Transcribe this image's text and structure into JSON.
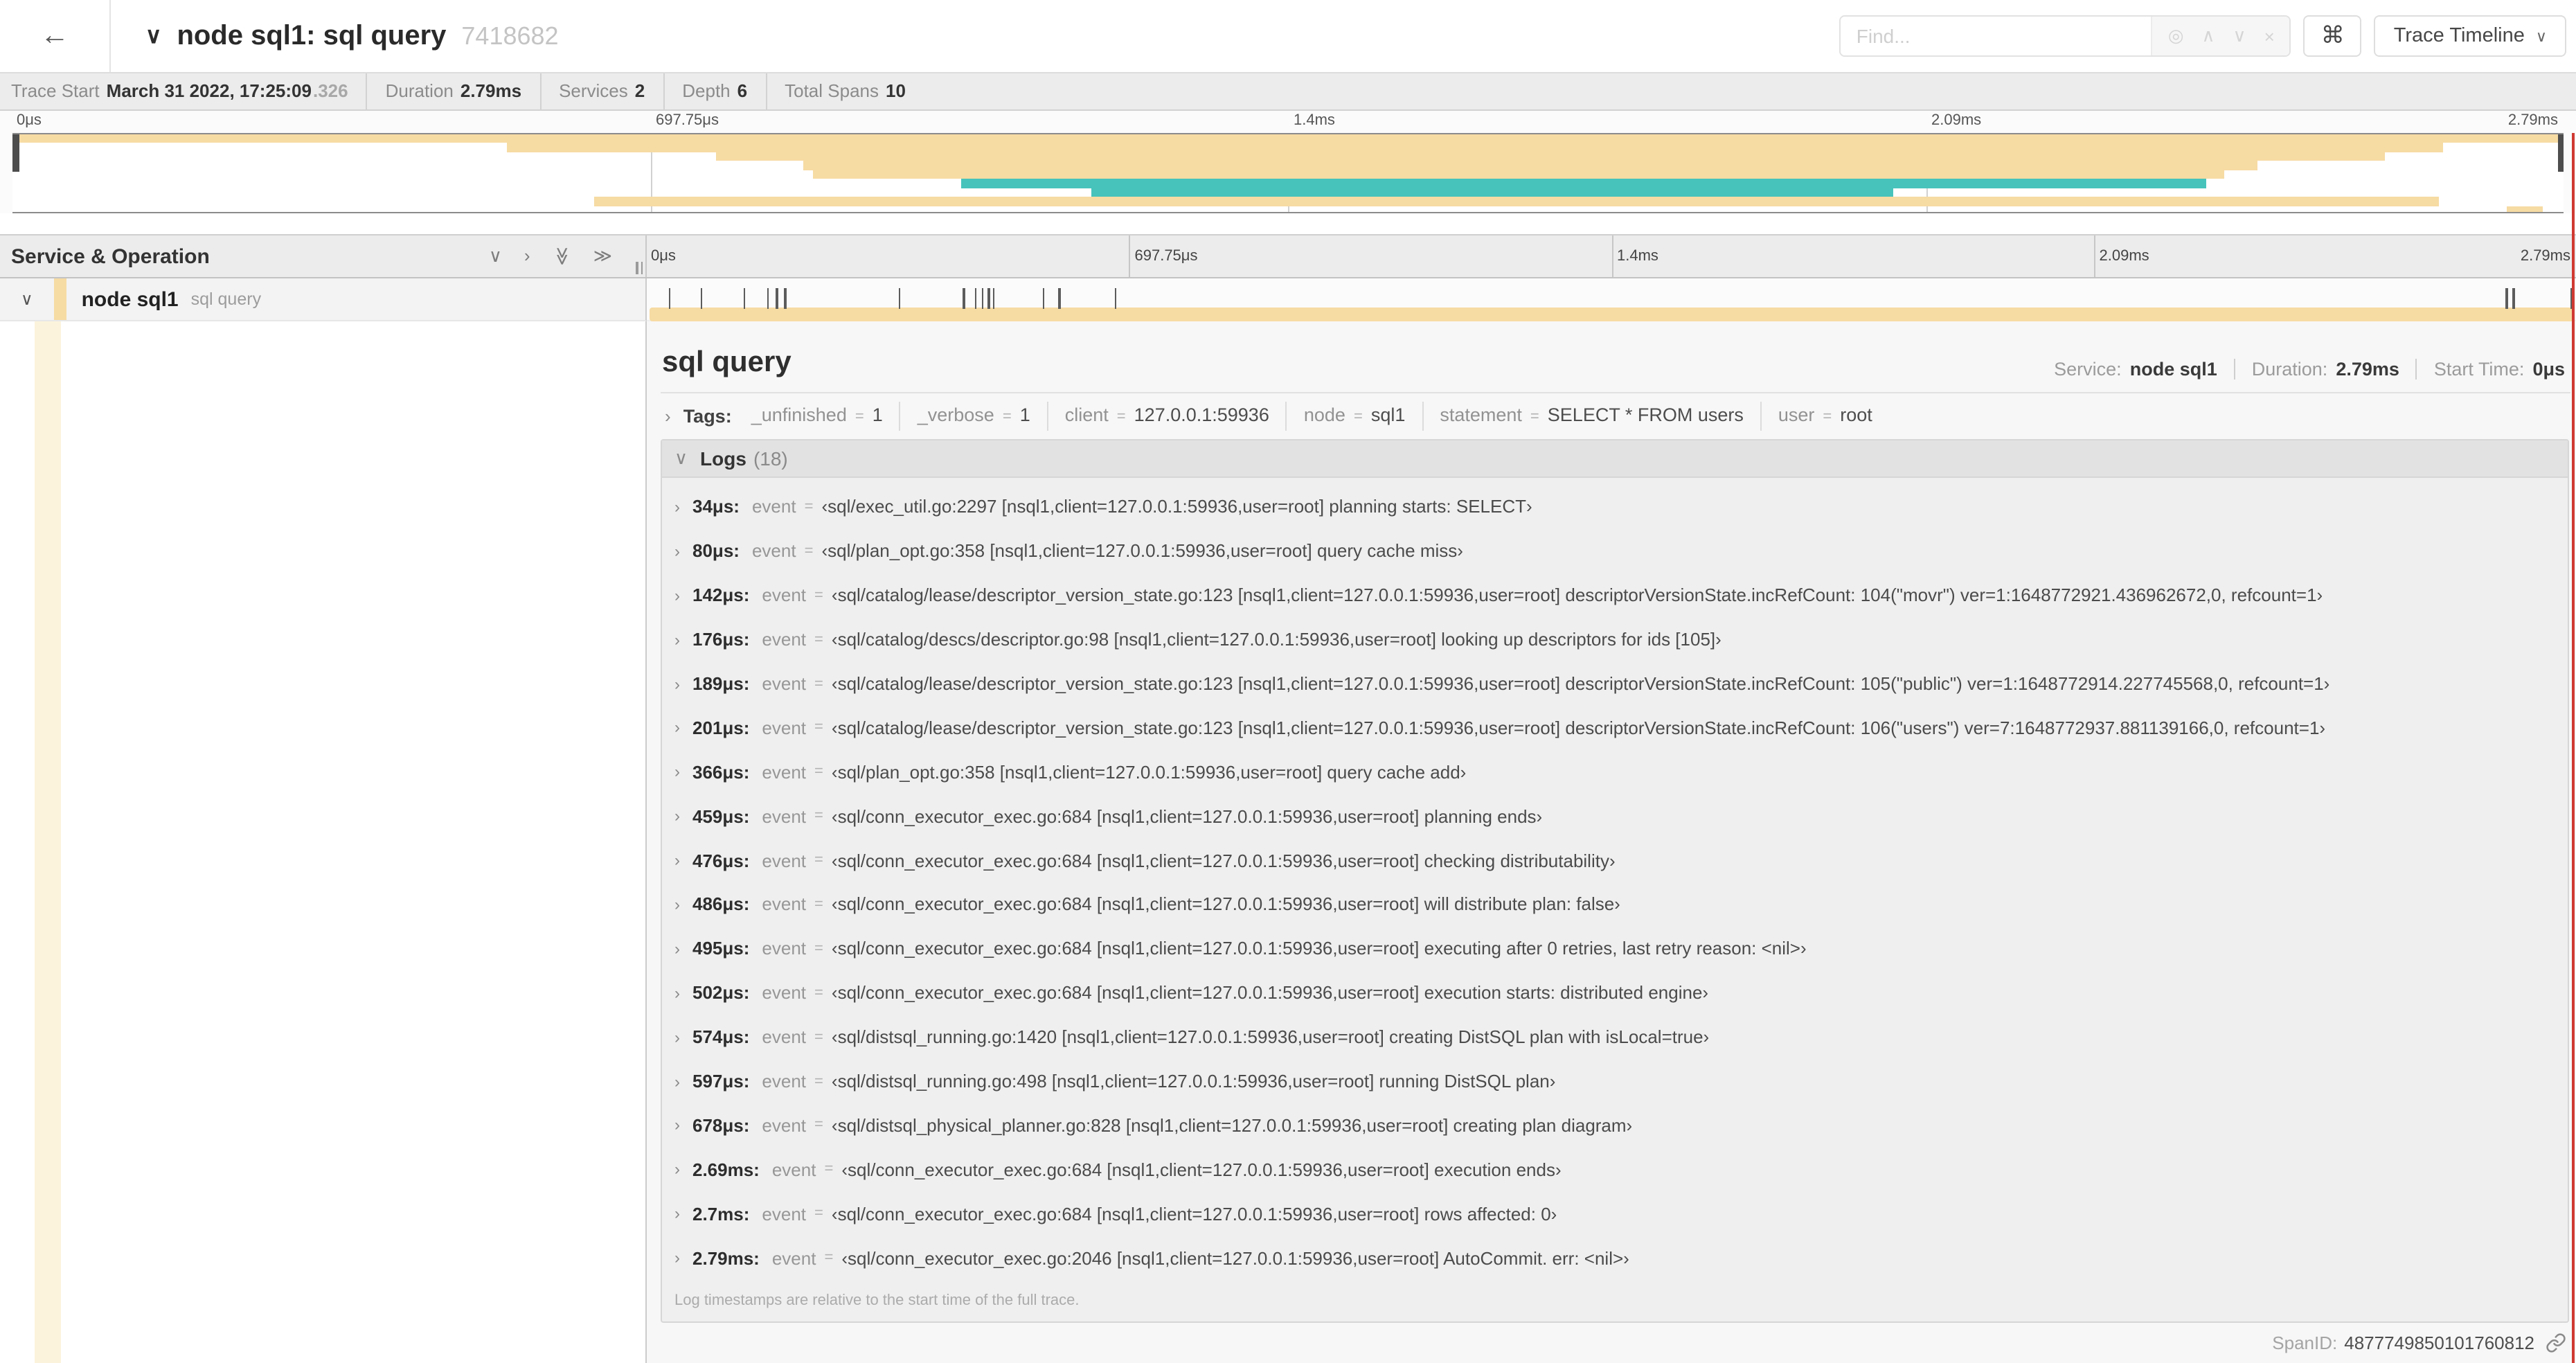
{
  "header": {
    "title": "node sql1: sql query",
    "trace_id": "7418682",
    "find": {
      "placeholder": "Find..."
    },
    "shortcut_key": "⌘",
    "view_selector": {
      "label": "Trace Timeline"
    }
  },
  "icons": {
    "back": "←",
    "chevron_down": "∨",
    "chevron_up": "∧",
    "chevron_right": "›",
    "double_chevron": "≫",
    "locate": "◎",
    "clear": "×",
    "command": "⌘",
    "caret_down": "∨"
  },
  "trace_info": {
    "items": [
      {
        "label": "Trace Start",
        "value": "March 31 2022, 17:25:09",
        "suffix": ".326"
      },
      {
        "label": "Duration",
        "value": "2.79ms"
      },
      {
        "label": "Services",
        "value": "2"
      },
      {
        "label": "Depth",
        "value": "6"
      },
      {
        "label": "Total Spans",
        "value": "10"
      }
    ]
  },
  "timeline": {
    "ticks": [
      "0μs",
      "697.75μs",
      "1.4ms",
      "2.09ms",
      "2.79ms"
    ],
    "duration_us": 2790
  },
  "minimap": {
    "bars": [
      {
        "row": 0,
        "start": 0,
        "end": 100,
        "color": "span_tan"
      },
      {
        "row": 1,
        "start": 19.4,
        "end": 95.3,
        "color": "span_tan"
      },
      {
        "row": 2,
        "start": 27.6,
        "end": 93.0,
        "color": "span_tan"
      },
      {
        "row": 3,
        "start": 31.0,
        "end": 88.0,
        "color": "span_tan"
      },
      {
        "row": 4,
        "start": 31.4,
        "end": 86.7,
        "color": "span_tan"
      },
      {
        "row": 5,
        "start": 37.2,
        "end": 86.0,
        "color": "span_teal"
      },
      {
        "row": 6,
        "start": 42.3,
        "end": 73.7,
        "color": "span_teal"
      },
      {
        "row": 7,
        "start": 22.8,
        "end": 95.1,
        "color": "span_tan"
      },
      {
        "row": 8,
        "start": 97.8,
        "end": 99.2,
        "color": "span_tan"
      }
    ]
  },
  "columns": {
    "left_header": "Service & Operation"
  },
  "span_row": {
    "service": "node sql1",
    "operation": "sql query",
    "log_marker_times_us": [
      34,
      80,
      142,
      176,
      189,
      201,
      366,
      459,
      476,
      486,
      495,
      502,
      574,
      597,
      678,
      2690,
      2700,
      2790
    ]
  },
  "span_detail": {
    "title": "sql query",
    "summary": [
      {
        "label": "Service:",
        "value": "node sql1"
      },
      {
        "label": "Duration:",
        "value": "2.79ms"
      },
      {
        "label": "Start Time:",
        "value": "0μs"
      }
    ],
    "tags_label": "Tags:",
    "tags": [
      {
        "key": "_unfinished",
        "value": "1"
      },
      {
        "key": "_verbose",
        "value": "1"
      },
      {
        "key": "client",
        "value": "127.0.0.1:59936"
      },
      {
        "key": "node",
        "value": "sql1"
      },
      {
        "key": "statement",
        "value": "SELECT * FROM users"
      },
      {
        "key": "user",
        "value": "root"
      }
    ],
    "logs": {
      "label": "Logs",
      "count": "(18)",
      "event_key": "event",
      "equals_sign": "=",
      "entries": [
        {
          "time": "34μs:",
          "message": "‹sql/exec_util.go:2297 [nsql1,client=127.0.0.1:59936,user=root] planning starts: SELECT›"
        },
        {
          "time": "80μs:",
          "message": "‹sql/plan_opt.go:358 [nsql1,client=127.0.0.1:59936,user=root] query cache miss›"
        },
        {
          "time": "142μs:",
          "message": "‹sql/catalog/lease/descriptor_version_state.go:123 [nsql1,client=127.0.0.1:59936,user=root] descriptorVersionState.incRefCount: 104(\"movr\") ver=1:1648772921.436962672,0, refcount=1›"
        },
        {
          "time": "176μs:",
          "message": "‹sql/catalog/descs/descriptor.go:98 [nsql1,client=127.0.0.1:59936,user=root] looking up descriptors for ids [105]›"
        },
        {
          "time": "189μs:",
          "message": "‹sql/catalog/lease/descriptor_version_state.go:123 [nsql1,client=127.0.0.1:59936,user=root] descriptorVersionState.incRefCount: 105(\"public\") ver=1:1648772914.227745568,0, refcount=1›"
        },
        {
          "time": "201μs:",
          "message": "‹sql/catalog/lease/descriptor_version_state.go:123 [nsql1,client=127.0.0.1:59936,user=root] descriptorVersionState.incRefCount: 106(\"users\") ver=7:1648772937.881139166,0, refcount=1›"
        },
        {
          "time": "366μs:",
          "message": "‹sql/plan_opt.go:358 [nsql1,client=127.0.0.1:59936,user=root] query cache add›"
        },
        {
          "time": "459μs:",
          "message": "‹sql/conn_executor_exec.go:684 [nsql1,client=127.0.0.1:59936,user=root] planning ends›"
        },
        {
          "time": "476μs:",
          "message": "‹sql/conn_executor_exec.go:684 [nsql1,client=127.0.0.1:59936,user=root] checking distributability›"
        },
        {
          "time": "486μs:",
          "message": "‹sql/conn_executor_exec.go:684 [nsql1,client=127.0.0.1:59936,user=root] will distribute plan: false›"
        },
        {
          "time": "495μs:",
          "message": "‹sql/conn_executor_exec.go:684 [nsql1,client=127.0.0.1:59936,user=root] executing after 0 retries, last retry reason: <nil>›"
        },
        {
          "time": "502μs:",
          "message": "‹sql/conn_executor_exec.go:684 [nsql1,client=127.0.0.1:59936,user=root] execution starts: distributed engine›"
        },
        {
          "time": "574μs:",
          "message": "‹sql/distsql_running.go:1420 [nsql1,client=127.0.0.1:59936,user=root] creating DistSQL plan with isLocal=true›"
        },
        {
          "time": "597μs:",
          "message": "‹sql/distsql_running.go:498 [nsql1,client=127.0.0.1:59936,user=root] running DistSQL plan›"
        },
        {
          "time": "678μs:",
          "message": "‹sql/distsql_physical_planner.go:828 [nsql1,client=127.0.0.1:59936,user=root] creating plan diagram›"
        },
        {
          "time": "2.69ms:",
          "message": "‹sql/conn_executor_exec.go:684 [nsql1,client=127.0.0.1:59936,user=root] execution ends›"
        },
        {
          "time": "2.7ms:",
          "message": "‹sql/conn_executor_exec.go:684 [nsql1,client=127.0.0.1:59936,user=root] rows affected: 0›"
        },
        {
          "time": "2.79ms:",
          "message": "‹sql/conn_executor_exec.go:2046 [nsql1,client=127.0.0.1:59936,user=root] AutoCommit. err: <nil>›"
        }
      ],
      "footnote": "Log timestamps are relative to the start time of the full trace."
    },
    "span_id_label": "SpanID:",
    "span_id": "4877749850101760812"
  },
  "colors": {
    "span_tan": "#f6dba3",
    "span_teal": "#47c3bb",
    "indent_band": "#fcf3dc",
    "cursor_guide": "#cf3a32"
  }
}
